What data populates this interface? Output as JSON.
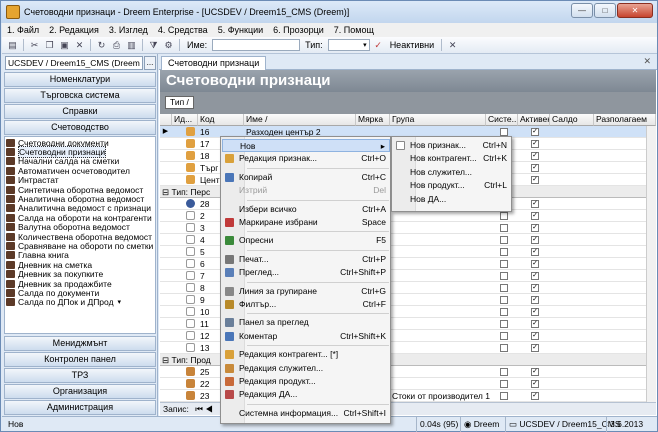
{
  "window": {
    "title": "Счетоводни признаци - Dreem Enterprise - [UCSDEV / Dreem15_CMS (Dreem)]",
    "min": "—",
    "max": "□",
    "close": "✕"
  },
  "menu": [
    "1. Файл",
    "2. Редакция",
    "3. Изглед",
    "4. Средства",
    "5. Функции",
    "6. Прозорци",
    "7. Помощ"
  ],
  "toolbar": {
    "name_label": "Име:",
    "type_label": "Тип:",
    "inactive_label": "Неактивни",
    "dropdown": "▾",
    "filter_icon": "✓",
    "clear_icon": "✕"
  },
  "sidebar": {
    "db_select": "UCSDEV / Dreem15_CMS (Dreem",
    "db_btn": "...",
    "top_buttons": [
      "Номенклатури",
      "Търговска система",
      "Справки",
      "Счетоводство"
    ],
    "items": [
      "Счетоводни документи",
      "Счетоводни признаци",
      "Начални салда на сметки",
      "Автоматичен осчетоводител",
      "Интрастат",
      "Синтетична оборотна ведомост",
      "Аналитична оборотна ведомост",
      "Аналитична ведомост с признаци",
      "Салда на обороти на контрагенти",
      "Валутна оборотна ведомост",
      "Количествена оборотна ведомост",
      "Сравняване на обороти по сметки",
      "Главна книга",
      "Дневник на сметка",
      "Дневник за покупките",
      "Дневник за продажбите",
      "Салда по документи",
      "Салда по ДПок и ДПрод"
    ],
    "more_arrow": "▾",
    "bottom_buttons": [
      "Мениджмънт",
      "Контролен панел",
      "ТРЗ",
      "Организация",
      "Администрация"
    ]
  },
  "main": {
    "tab": "Счетоводни признаци",
    "banner": "Счетоводни признаци",
    "group_tag": "Тип",
    "columns": [
      "",
      "Ид...",
      "Код",
      "Име",
      "Мярка",
      "Група",
      "Систе...",
      "Активен",
      "Салдо",
      "Разполагаем"
    ],
    "rows_a": [
      {
        "code": "16",
        "name": "Разходен център 2",
        "active": true,
        "selected": true
      },
      {
        "code": "17",
        "name": "",
        "active": true
      },
      {
        "code": "18",
        "name": "",
        "active": true
      },
      {
        "code": "Търг",
        "name": "",
        "active": true
      },
      {
        "code": "Цент",
        "name": "",
        "active": true
      }
    ],
    "group_b": "Тип: Перс",
    "rows_b": [
      {
        "code": "28",
        "active": true
      },
      {
        "code": "2",
        "active": true
      },
      {
        "code": "3",
        "active": true
      },
      {
        "code": "4",
        "active": true
      },
      {
        "code": "5",
        "active": true
      },
      {
        "code": "6",
        "active": true
      },
      {
        "code": "7",
        "active": true
      },
      {
        "code": "8",
        "active": true
      },
      {
        "code": "9",
        "active": true
      },
      {
        "code": "10",
        "active": true
      },
      {
        "code": "11",
        "active": true
      },
      {
        "code": "12",
        "active": true
      },
      {
        "code": "13",
        "active": true
      }
    ],
    "group_c": "Тип: Прод",
    "rows_c": [
      {
        "code": "25",
        "group": "",
        "active": true
      },
      {
        "code": "22",
        "group": "",
        "active": true
      },
      {
        "code": "23",
        "group": "Стоки от производител 1",
        "active": true
      },
      {
        "code": "24",
        "group": "",
        "active": true
      }
    ],
    "navigator_label": "Запис:"
  },
  "context_menu": [
    {
      "label": "Нов",
      "shortcut": "▸",
      "icon": "",
      "state": "highlight"
    },
    {
      "label": "Редакция признак...",
      "shortcut": "Ctrl+O",
      "icon": "#d9a13a"
    },
    {
      "sep": true
    },
    {
      "label": "Копирай",
      "shortcut": "Ctrl+C",
      "icon": "#4a76b8"
    },
    {
      "label": "Изтрий",
      "shortcut": "Del",
      "icon": "",
      "state": "disabled"
    },
    {
      "sep": true
    },
    {
      "label": "Избери всичко",
      "shortcut": "Ctrl+A",
      "icon": ""
    },
    {
      "label": "Маркиране избрани",
      "shortcut": "Space",
      "icon": "#c03a3a"
    },
    {
      "sep": true
    },
    {
      "label": "Опресни",
      "shortcut": "F5",
      "icon": "#3a8a3a"
    },
    {
      "sep": true
    },
    {
      "label": "Печат...",
      "shortcut": "Ctrl+P",
      "icon": "#777"
    },
    {
      "label": "Преглед...",
      "shortcut": "Ctrl+Shift+P",
      "icon": "#5a7fb8"
    },
    {
      "sep": true
    },
    {
      "label": "Линия за групиране",
      "shortcut": "Ctrl+G",
      "icon": "#888"
    },
    {
      "label": "Филтър...",
      "shortcut": "Ctrl+F",
      "icon": "#b88a2a"
    },
    {
      "sep": true
    },
    {
      "label": "Панел за преглед",
      "shortcut": "",
      "icon": "#6a7f9a"
    },
    {
      "label": "Коментар",
      "shortcut": "Ctrl+Shift+K",
      "icon": "#4a76b8"
    },
    {
      "sep": true
    },
    {
      "label": "Редакция контрагент... [*]",
      "shortcut": "",
      "icon": "#d9a13a"
    },
    {
      "label": "Редакция служител...",
      "shortcut": "",
      "icon": "#c88a3a"
    },
    {
      "label": "Редакция продукт...",
      "shortcut": "",
      "icon": "#c86a3a"
    },
    {
      "label": "Редакция ДА...",
      "shortcut": "",
      "icon": "#b84a4a"
    },
    {
      "sep": true
    },
    {
      "label": "Системна информация...",
      "shortcut": "Ctrl+Shift+I",
      "icon": ""
    }
  ],
  "submenu": [
    {
      "label": "Нов признак...",
      "shortcut": "Ctrl+N",
      "icon": "#fff"
    },
    {
      "label": "Нов контрагент...",
      "shortcut": "Ctrl+K",
      "icon": ""
    },
    {
      "label": "Нов служител...",
      "shortcut": "",
      "icon": ""
    },
    {
      "label": "Нов продукт...",
      "shortcut": "Ctrl+L",
      "icon": ""
    },
    {
      "label": "Нов ДА...",
      "shortcut": "",
      "icon": ""
    }
  ],
  "status": {
    "mode": "Нов",
    "time": "0.04s (95)",
    "db": "Dreem",
    "conn": "UCSDEV / Dreem15_CMS",
    "date": "3.6.2013"
  }
}
